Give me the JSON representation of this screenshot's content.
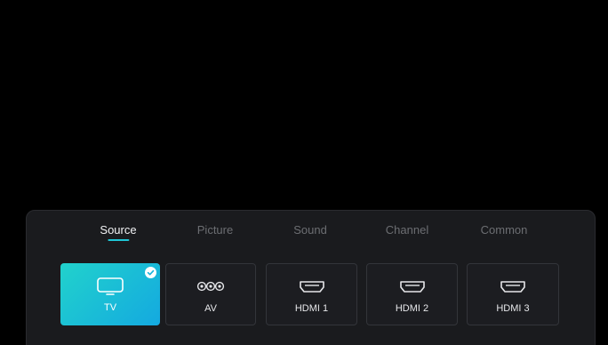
{
  "tabs": [
    {
      "label": "Source",
      "active": true
    },
    {
      "label": "Picture",
      "active": false
    },
    {
      "label": "Sound",
      "active": false
    },
    {
      "label": "Channel",
      "active": false
    },
    {
      "label": "Common",
      "active": false
    }
  ],
  "sources": [
    {
      "label": "TV",
      "icon": "tv-icon",
      "selected": true
    },
    {
      "label": "AV",
      "icon": "av-connector-icon",
      "selected": false
    },
    {
      "label": "HDMI 1",
      "icon": "hdmi-port-icon",
      "selected": false
    },
    {
      "label": "HDMI 2",
      "icon": "hdmi-port-icon",
      "selected": false
    },
    {
      "label": "HDMI 3",
      "icon": "hdmi-port-icon",
      "selected": false
    }
  ],
  "colors": {
    "accent": "#1fc6d6",
    "selected_gradient_start": "#21d2cc",
    "selected_gradient_end": "#14a9e0",
    "panel_background": "#1a1b1e",
    "inactive_tab_text": "#6c6e72"
  }
}
